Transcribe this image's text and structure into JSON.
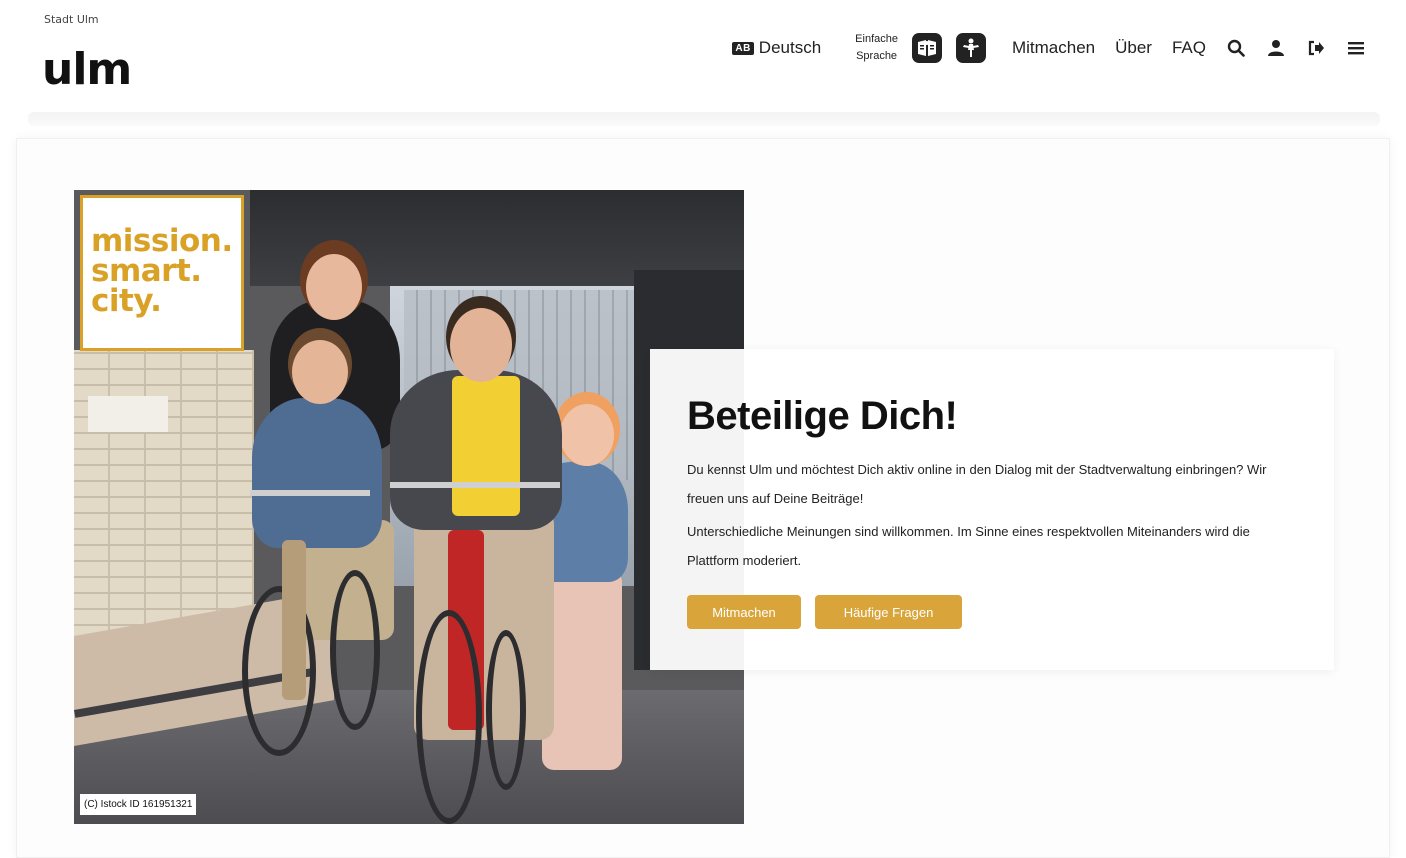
{
  "header": {
    "brand_small": "Stadt Ulm",
    "brand_logo": "ulm",
    "language_badge": "AB",
    "language": "Deutsch",
    "simple_language_line1": "Einfache",
    "simple_language_line2": "Sprache",
    "nav_links": [
      "Mitmachen",
      "Über",
      "FAQ"
    ],
    "icons": [
      "search-icon",
      "user-icon",
      "login-icon",
      "menu-icon"
    ],
    "accessibility_icons": [
      "easy-read-book-icon",
      "sign-language-icon"
    ]
  },
  "hero": {
    "mission_lines": [
      "mission.",
      "smart.",
      "city."
    ],
    "caption": "(C) Istock ID 161951321"
  },
  "content": {
    "title": "Beteilige Dich!",
    "paragraph1": "Du kennst Ulm und möchtest Dich aktiv online in den Dialog mit der Stadtverwaltung einbringen? Wir freuen uns auf Deine Beiträge!",
    "paragraph2": "Unterschiedliche Meinungen sind willkommen. Im Sinne eines respektvollen Miteinanders wird die Plattform moderiert.",
    "button_primary": "Mitmachen",
    "button_secondary": "Häufige Fragen"
  },
  "colors": {
    "accent": "#d9a53a",
    "mission_gold": "#d9a227",
    "text": "#111111",
    "background": "#ffffff"
  }
}
